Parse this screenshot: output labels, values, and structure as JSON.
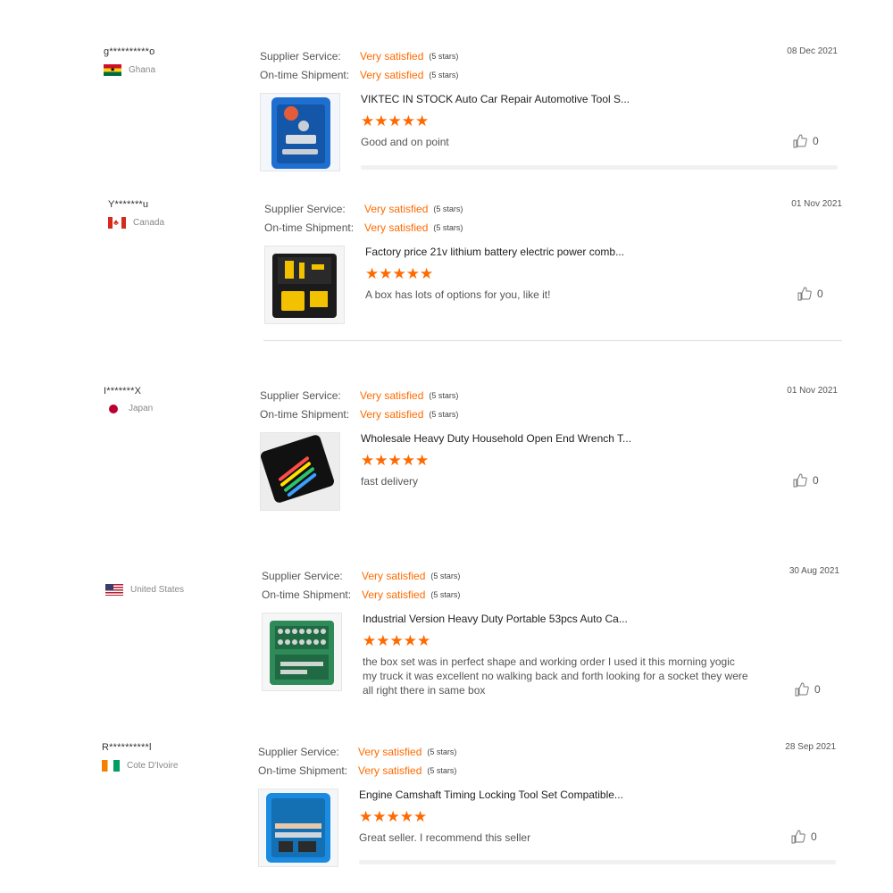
{
  "labels": {
    "supplier_service": "Supplier Service:",
    "on_time_shipment": "On-time Shipment:"
  },
  "reviews": [
    {
      "user": "g**********o",
      "country": "Ghana",
      "flag_icon": "ghana-flag-icon",
      "supplier_rating": "Very satisfied",
      "supplier_stars": "(5 stars)",
      "shipment_rating": "Very satisfied",
      "shipment_stars": "(5 stars)",
      "date": "08 Dec 2021",
      "product_title": "VIKTEC IN STOCK Auto Car Repair Automotive Tool S...",
      "stars": "★★★★★",
      "comment": "Good and on point",
      "likes": "0"
    },
    {
      "user": "Y*******u",
      "country": "Canada",
      "flag_icon": "canada-flag-icon",
      "supplier_rating": "Very satisfied",
      "supplier_stars": "(5 stars)",
      "shipment_rating": "Very satisfied",
      "shipment_stars": "(5 stars)",
      "date": "01 Nov 2021",
      "product_title": "Factory price 21v lithium battery electric power comb...",
      "stars": "★★★★★",
      "comment": "A box has lots of options for you, like it!",
      "likes": "0"
    },
    {
      "user": "I*******X",
      "country": "Japan",
      "flag_icon": "japan-flag-icon",
      "supplier_rating": "Very satisfied",
      "supplier_stars": "(5 stars)",
      "shipment_rating": "Very satisfied",
      "shipment_stars": "(5 stars)",
      "date": "01 Nov 2021",
      "product_title": "Wholesale Heavy Duty Household Open End Wrench T...",
      "stars": "★★★★★",
      "comment": "fast delivery",
      "likes": "0"
    },
    {
      "user": "",
      "country": "United States",
      "flag_icon": "united-states-flag-icon",
      "supplier_rating": "Very satisfied",
      "supplier_stars": "(5 stars)",
      "shipment_rating": "Very satisfied",
      "shipment_stars": "(5 stars)",
      "date": "30 Aug 2021",
      "product_title": "Industrial Version Heavy Duty Portable 53pcs Auto Ca...",
      "stars": "★★★★★",
      "comment": "the box set was in perfect shape and working order I used it this morning yogic my truck it was excellent no walking back and forth looking for a socket they were all right there in same box",
      "likes": "0"
    },
    {
      "user": "R**********l",
      "country": "Cote D'Ivoire",
      "flag_icon": "cote-divoire-flag-icon",
      "supplier_rating": "Very satisfied",
      "supplier_stars": "(5 stars)",
      "shipment_rating": "Very satisfied",
      "shipment_stars": "(5 stars)",
      "date": "28 Sep 2021",
      "product_title": "Engine Camshaft Timing Locking Tool Set Compatible...",
      "stars": "★★★★★",
      "comment": "Great seller. I recommend this seller",
      "likes": "0"
    }
  ],
  "colors": {
    "accent": "#ff6a00",
    "text": "#333333",
    "muted": "#888888"
  }
}
